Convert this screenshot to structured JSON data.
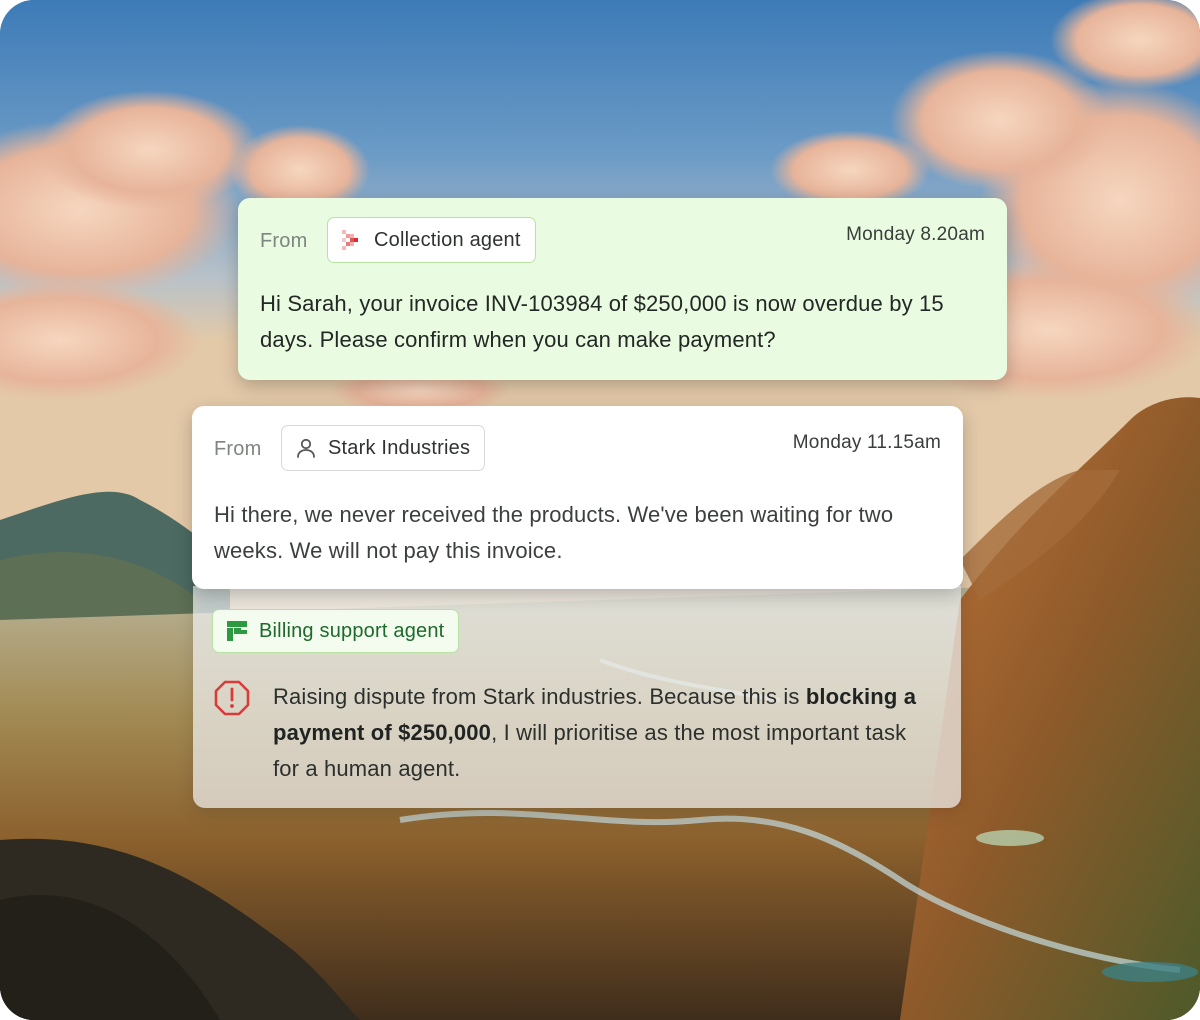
{
  "collection_card": {
    "from_label": "From",
    "sender": "Collection agent",
    "sender_icon": "collection-agent-logo-icon",
    "timestamp": "Monday 8.20am",
    "message": "Hi Sarah, your invoice INV-103984 of $250,000 is now overdue by 15 days. Please confirm when you can make payment?"
  },
  "stark_card": {
    "from_label": "From",
    "sender": "Stark Industries",
    "sender_icon": "person-icon",
    "timestamp": "Monday 11.15am",
    "message": "Hi there, we never received the products. We've been waiting for two weeks. We will not pay this invoice."
  },
  "billing_card": {
    "agent": "Billing support agent",
    "agent_icon": "billing-agent-logo-icon",
    "alert_icon": "alert-octagon-icon",
    "alert_text_before": "Raising dispute from Stark industries. Because this is ",
    "alert_text_bold": "blocking a payment of $250,000",
    "alert_text_after": ", I will prioritise as the most important task for a human agent."
  },
  "colors": {
    "collection_card_bg": "#e9fbe0",
    "chip_border_green": "#b7e3a2",
    "billing_text_green": "#1d6a2b",
    "alert_red": "#d93a3a"
  }
}
